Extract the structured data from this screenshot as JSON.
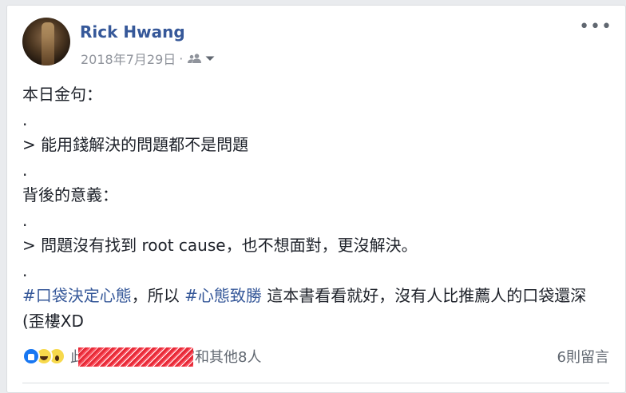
{
  "post": {
    "author": "Rick Hwang",
    "date": "2018年7月29日",
    "separator": "·",
    "audience_icon": "friends-icon",
    "more_icon": "more-icon",
    "more_label": "•••"
  },
  "body": {
    "line1": "本日金句：",
    "line2": ".",
    "line3": "> 能用錢解決的問題都不是問題",
    "line4": ".",
    "line5": "背後的意義：",
    "line6": ".",
    "line7": "> 問題沒有找到 root cause，也不想面對，更沒解決。",
    "line8": ".",
    "hashtag1": "#口袋決定心態",
    "text_after_hashtag1": "，所以 ",
    "hashtag2": "#心態致勝",
    "text_after_hashtag2": " 這本書看看就好，沒有人比推薦人的口袋還深 (歪樓XD"
  },
  "footer": {
    "reactions": [
      "like-icon",
      "haha-icon",
      "wow-icon"
    ],
    "reaction_prefix": "此",
    "reaction_suffix": "富和其他8人",
    "comments": "6則留言"
  },
  "colors": {
    "link": "#365899",
    "text": "#1d2129",
    "meta": "#90949c",
    "like": "#1877f2"
  }
}
